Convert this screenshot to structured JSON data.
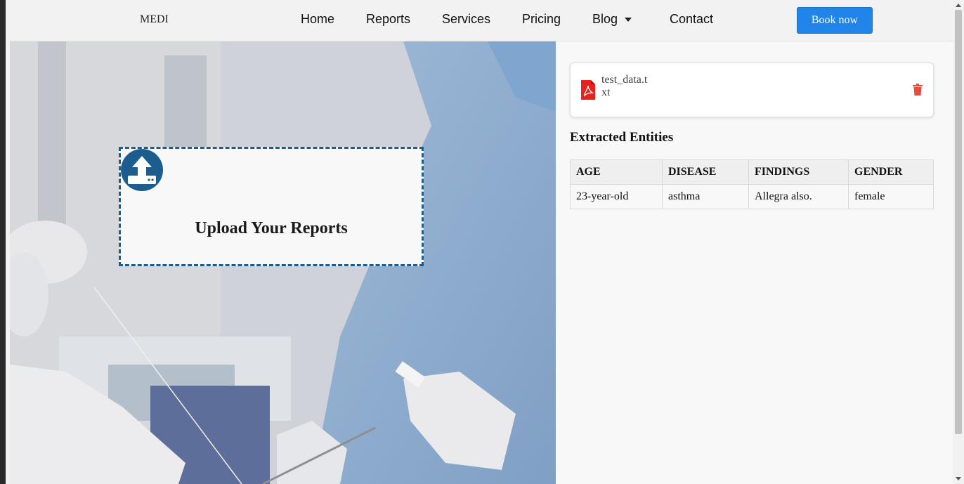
{
  "navbar": {
    "brand": "MEDI",
    "links": [
      "Home",
      "Reports",
      "Services",
      "Pricing",
      "Blog",
      "Contact"
    ],
    "book_label": "Book now"
  },
  "upload": {
    "title": "Upload Your Reports",
    "icon": "upload-icon"
  },
  "file": {
    "name": "test_data.txt",
    "icon": "pdf-icon",
    "delete_icon": "trash-icon"
  },
  "entities": {
    "title": "Extracted Entities",
    "headers": [
      "AGE",
      "DISEASE",
      "FINDINGS",
      "GENDER"
    ],
    "rows": [
      [
        "23-year-old",
        "asthma",
        "Allegra also.",
        "female"
      ]
    ]
  },
  "colors": {
    "accent": "#2184e8",
    "upload_border": "#1c5d8f",
    "pdf": "#e8211e",
    "trash": "#e74c3c"
  }
}
